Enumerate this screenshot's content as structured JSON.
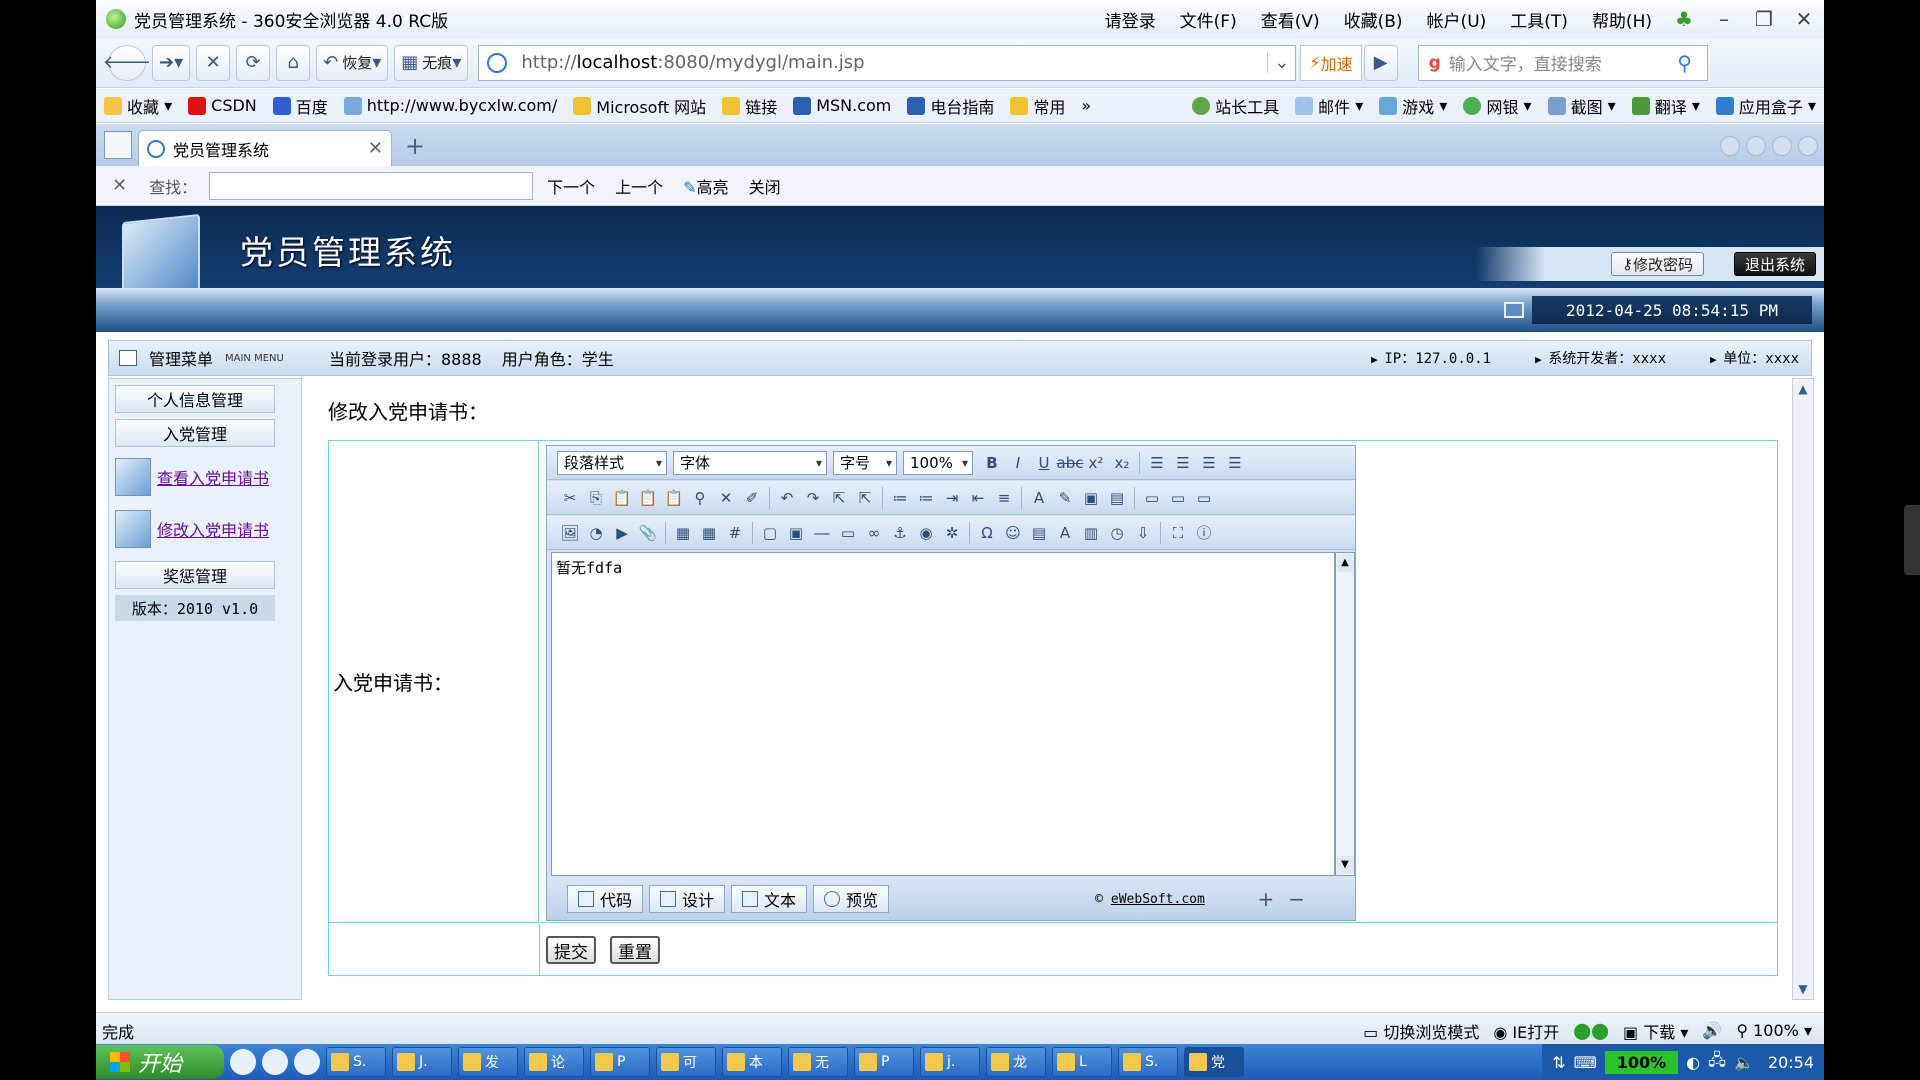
{
  "browser": {
    "window_title": "党员管理系统 - 360安全浏览器 4.0 RC版",
    "login": "请登录",
    "menus": [
      "文件(F)",
      "查看(V)",
      "收藏(B)",
      "帐户(U)",
      "工具(T)",
      "帮助(H)"
    ],
    "nav": {
      "restore_label": "恢复",
      "notrace_label": "无痕",
      "url_prefix": "http://",
      "url_host": "localhost",
      "url_rest": ":8080/mydygl/main.jsp",
      "speed_label": "加速",
      "search_placeholder": "输入文字，直接搜索"
    },
    "favorites": [
      "收藏",
      "CSDN",
      "百度",
      "http://www.bycxlw.com/",
      "Microsoft 网站",
      "链接",
      "MSN.com",
      "电台指南",
      "常用"
    ],
    "favorites_more": "»",
    "tools": [
      "站长工具",
      "邮件",
      "游戏",
      "网银",
      "截图",
      "翻译",
      "应用盒子"
    ],
    "tab_title": "党员管理系统",
    "find": {
      "label": "查找：",
      "next": "下一个",
      "prev": "上一个",
      "highlight": "高亮",
      "close": "关闭"
    },
    "status_text": "完成",
    "status_right": [
      "切换浏览模式",
      "IE打开",
      "下载",
      "100%"
    ]
  },
  "app": {
    "system_name": "党员管理系统",
    "change_password": "修改密码",
    "logout": "退出系统",
    "datetime": "2012-04-25 08:54:15 PM",
    "menu_header": "管理菜单",
    "menu_header_en": "MAIN MENU",
    "current_user": "当前登录用户：8888",
    "user_role": "用户角色：学生",
    "ip": "IP：127.0.0.1",
    "developer": "系统开发者：xxxx",
    "unit": "单位：xxxx",
    "sidebar": {
      "personal_info": "个人信息管理",
      "party_admission": "入党管理",
      "view_application": "查看入党申请书",
      "edit_application": "修改入党申请书",
      "rewards": "奖惩管理",
      "version": "版本：2010 v1.0"
    },
    "content": {
      "heading": "修改入党申请书：",
      "field_label": "入党申请书：",
      "submit": "提交",
      "reset": "重置"
    },
    "editor": {
      "paragraph_style": "段落样式",
      "font": "字体",
      "font_size": "字号",
      "zoom": "100%",
      "text": "暂无fdfa",
      "modes": [
        "代码",
        "设计",
        "文本",
        "预览"
      ],
      "copyright_symbol": "©",
      "copyright_link": "eWebSoft.com"
    }
  },
  "taskbar": {
    "start": "开始",
    "tasks": [
      "S.",
      "J.",
      "发",
      "论",
      "P",
      "可",
      "本",
      "无",
      "P",
      "j.",
      "龙",
      "L",
      "S.",
      "党"
    ],
    "zoom": "100%",
    "clock": "20:54"
  }
}
